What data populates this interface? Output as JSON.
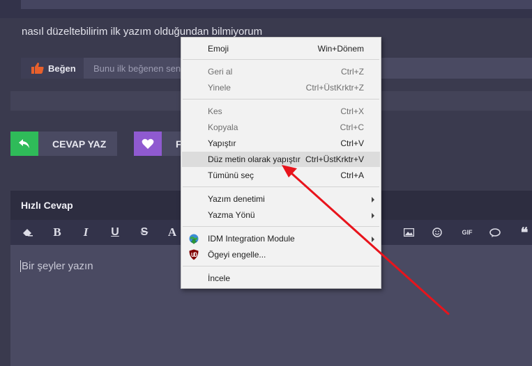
{
  "post": {
    "text": "nasıl düzeltebilirim ilk yazım olduğundan bilmiyorum",
    "like_label": "Beğen",
    "like_hint": "Bunu ilk beğenen sen o"
  },
  "actions": {
    "reply_label": "CEVAP YAZ",
    "fav_label_partial": "F"
  },
  "quick_reply": {
    "title": "Hızlı Cevap",
    "placeholder": "Bir şeyler yazın"
  },
  "toolbar": {
    "bold": "B",
    "italic": "I",
    "underline": "U",
    "strike": "S",
    "font_color": "A",
    "gif": "GIF",
    "quote": "❝"
  },
  "context_menu": {
    "emoji": {
      "label": "Emoji",
      "shortcut": "Win+Dönem"
    },
    "undo": {
      "label": "Geri al",
      "shortcut": "Ctrl+Z"
    },
    "redo": {
      "label": "Yinele",
      "shortcut": "Ctrl+ÜstKrktr+Z"
    },
    "cut": {
      "label": "Kes",
      "shortcut": "Ctrl+X"
    },
    "copy": {
      "label": "Kopyala",
      "shortcut": "Ctrl+C"
    },
    "paste": {
      "label": "Yapıştır",
      "shortcut": "Ctrl+V"
    },
    "paste_plain": {
      "label": "Düz metin olarak yapıştır",
      "shortcut": "Ctrl+ÜstKrktr+V"
    },
    "select_all": {
      "label": "Tümünü seç",
      "shortcut": "Ctrl+A"
    },
    "spellcheck": {
      "label": "Yazım denetimi"
    },
    "writing_direction": {
      "label": "Yazma Yönü"
    },
    "idm": {
      "label": "IDM Integration Module"
    },
    "block_element": {
      "label": "Ögeyi engelle..."
    },
    "inspect": {
      "label": "İncele"
    }
  },
  "colors": {
    "page_bg": "#3a3a4e",
    "reply_accent": "#2fbb59",
    "fav_accent": "#8f5ad0",
    "like_accent": "#e8602c",
    "annotation_arrow": "#e8141c"
  }
}
